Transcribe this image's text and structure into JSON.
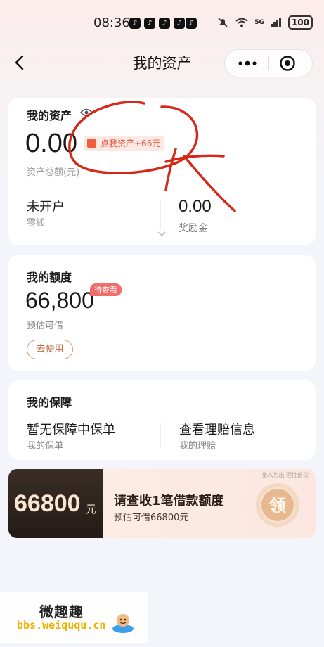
{
  "status_bar": {
    "time": "08:36",
    "network": "5G",
    "battery": "100"
  },
  "nav": {
    "title": "我的资产"
  },
  "assets": {
    "title": "我的资产",
    "amount": "0.00",
    "promo": "点我资产+66元",
    "sub_label": "资产总额(元)",
    "col1_value": "未开户",
    "col1_label": "零钱",
    "col2_value": "0.00",
    "col2_label": "奖励金"
  },
  "quota": {
    "title": "我的额度",
    "amount": "66,800",
    "tag": "待查看",
    "sub_label": "预估可借",
    "button": "去使用"
  },
  "protection": {
    "title": "我的保障",
    "col1_value": "暂无保障中保单",
    "col1_label": "我的保单",
    "col2_value": "查看理赔信息",
    "col2_label": "我的理赔"
  },
  "banner": {
    "amount": "66800",
    "unit": "元",
    "title": "请查收1笔借款额度",
    "subtitle": "预估可借66800元",
    "corner_text": "量入为出 理性借贷",
    "seal_text": "领"
  },
  "watermark": {
    "line1": "微趣趣",
    "line2": "bbs.weiququ.cn"
  },
  "colors": {
    "accent_red": "#e5533d",
    "tag_red": "#f06d6d",
    "button_brown": "#c56a3e",
    "annotation_red": "#d62818"
  }
}
